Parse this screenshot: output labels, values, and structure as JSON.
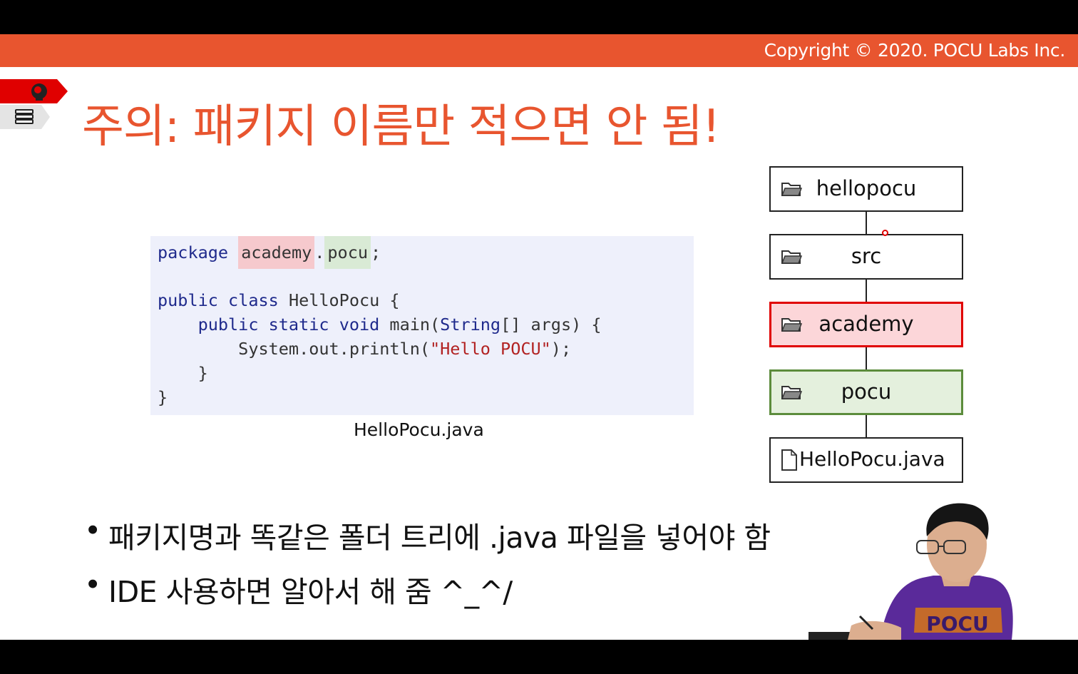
{
  "header": {
    "copyright": "Copyright © 2020. POCU Labs Inc."
  },
  "slide": {
    "title": "주의: 패키지 이름만 적으면 안 됨!"
  },
  "code": {
    "kw_package": "package",
    "pkg_part1": "academy",
    "pkg_dot": ".",
    "pkg_part2": "pocu",
    "pkg_semicolon": ";",
    "kw_public1": "public",
    "kw_class": "class",
    "class_rest": " HelloPocu {",
    "indent1": "    ",
    "kw_public2": "public",
    "kw_static": "static",
    "kw_void": "void",
    "main_sig1": " main(",
    "kw_string": "String",
    "main_sig2": "[] args) {",
    "println_pre": "        System.out.println(",
    "println_str": "\"Hello POCU\"",
    "println_post": ");",
    "close_inner": "    }",
    "close_outer": "}"
  },
  "code_caption": "HelloPocu.java",
  "tree": {
    "nodes": [
      {
        "label": "hellopocu",
        "icon": "folder-icon"
      },
      {
        "label": "src",
        "icon": "folder-icon"
      },
      {
        "label": "academy",
        "icon": "folder-icon"
      },
      {
        "label": "pocu",
        "icon": "folder-icon"
      },
      {
        "label": "HelloPocu.java",
        "icon": "file-icon"
      }
    ]
  },
  "bullets": [
    {
      "dot": "•",
      "text": "패키지명과 똑같은 폴더 트리에 .java 파일을 넣어야 함"
    },
    {
      "dot": "•",
      "text": "IDE 사용하면 알아서 해 줌 ^_^/"
    }
  ],
  "presenter": {
    "shirt_text": "POCU"
  },
  "colors": {
    "accent": "#e8552f",
    "keyword": "#1f2a8c",
    "string": "#b22222",
    "highlight_red": "#f6c9cd",
    "highlight_green": "#d9ead5"
  }
}
